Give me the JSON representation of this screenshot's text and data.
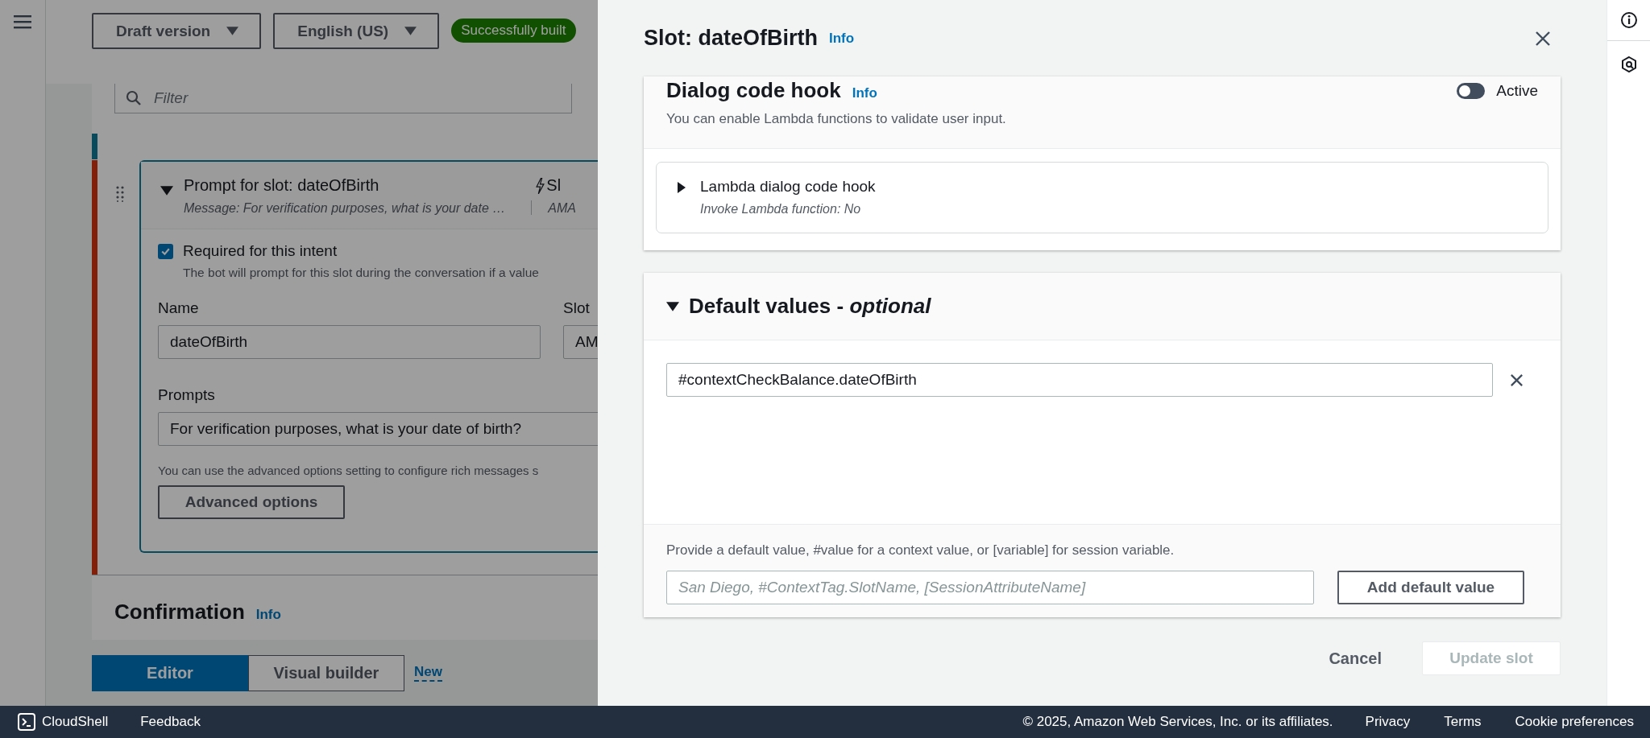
{
  "page": {
    "top_bar": {
      "version_dropdown": "Draft version",
      "language_dropdown": "English (US)",
      "build_status": "Successfully built"
    },
    "filter": {
      "placeholder": "Filter"
    },
    "slot_card": {
      "title": "Prompt for slot: dateOfBirth",
      "message": "Message: For verification purposes, what is your date …",
      "expanded": true,
      "column_2_title": "Sl",
      "column_2_subtitle": "AMA",
      "required": {
        "label": "Required for this intent",
        "checked": true,
        "description": "The bot will prompt for this slot during the conversation if a value"
      },
      "name_label": "Name",
      "name_value": "dateOfBirth",
      "slot_type_label": "Slot",
      "slot_type_value": "AM",
      "prompts_label": "Prompts",
      "prompt_value": "For verification purposes, what is your date of birth?",
      "advanced_hint": "You can use the advanced options setting to configure rich messages s",
      "advanced_button": "Advanced options"
    },
    "confirmation": {
      "title": "Confirmation",
      "info": "Info"
    },
    "view_tabs": [
      {
        "label": "Editor",
        "selected": true
      },
      {
        "label": "Visual builder",
        "selected": false
      }
    ],
    "new_link": "New"
  },
  "panel": {
    "title": "Slot: dateOfBirth",
    "info": "Info",
    "dialog_code_hook": {
      "title": "Dialog code hook",
      "info": "Info",
      "toggle": {
        "label": "Active",
        "on": false
      },
      "description": "You can enable Lambda functions to validate user input.",
      "lambda": {
        "title": "Lambda dialog code hook",
        "subtitle": "Invoke Lambda function: No",
        "expanded": false
      }
    },
    "default_values": {
      "title": "Default values - *optional*",
      "expanded": true,
      "values": [
        "#contextCheckBalance.dateOfBirth"
      ],
      "hint": "Provide a default value, #value for a context value, or [variable] for session variable.",
      "placeholder": "San Diego, #ContextTag.SlotName, [SessionAttributeName]",
      "add_button": "Add default value"
    },
    "cancel_button": "Cancel",
    "update_button": {
      "label": "Update slot",
      "disabled": true
    }
  },
  "footer": {
    "cloudshell": "CloudShell",
    "feedback": "Feedback",
    "copyright": "© 2025, Amazon Web Services, Inc. or its affiliates.",
    "links": [
      "Privacy",
      "Terms",
      "Cookie preferences"
    ]
  }
}
